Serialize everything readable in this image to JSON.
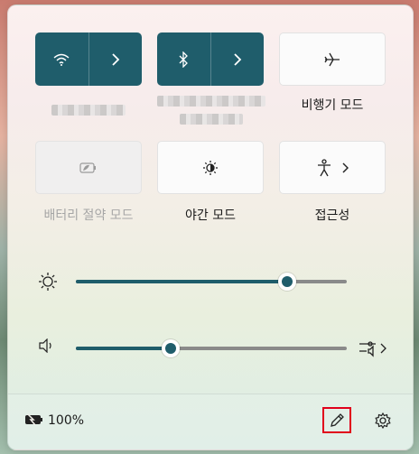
{
  "tiles": {
    "wifi": {
      "icon": "wifi-icon",
      "state": "on"
    },
    "bluetooth": {
      "icon": "bluetooth-icon",
      "state": "on"
    },
    "airplane": {
      "label": "비행기 모드",
      "icon": "airplane-icon",
      "state": "off"
    },
    "battery_saver": {
      "label": "배터리 절약 모드",
      "icon": "battery-saver-icon",
      "state": "disabled"
    },
    "night_light": {
      "label": "야간 모드",
      "icon": "night-light-icon",
      "state": "off"
    },
    "accessibility": {
      "label": "접근성",
      "icon": "accessibility-icon",
      "state": "off"
    }
  },
  "sliders": {
    "brightness": {
      "icon": "brightness-icon",
      "value": 0.78
    },
    "volume": {
      "icon": "speaker-icon",
      "value": 0.35,
      "aux_icon": "audio-output-icon"
    }
  },
  "footer": {
    "battery_text": "100%",
    "battery_icon": "battery-charging-icon",
    "edit_icon": "pencil-edit-icon",
    "settings_icon": "gear-icon"
  },
  "colors": {
    "accent": "#1f5d6b",
    "highlight": "#e0001b"
  }
}
